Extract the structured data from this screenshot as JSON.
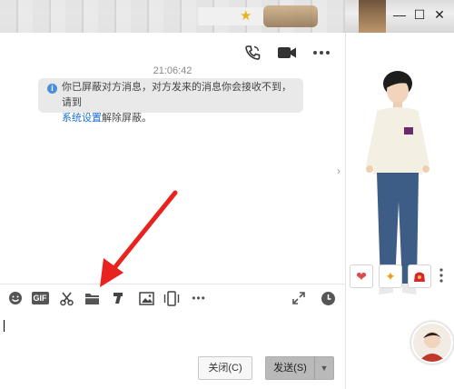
{
  "window": {
    "minimize_glyph": "—",
    "maximize_glyph": "☐",
    "close_glyph": "✕"
  },
  "header": {
    "icons": [
      "phone-icon",
      "video-call-icon",
      "more-icon"
    ]
  },
  "chat": {
    "timestamp": "21:06:42",
    "notice_text": "你已屏蔽对方消息，对方发来的消息你会接收不到，请到",
    "notice_link": "系统设置",
    "notice_tail": "解除屏蔽。"
  },
  "toolbar": {
    "gif_label": "GIF",
    "more_glyph": "•••",
    "tools": [
      "emoji-icon",
      "gif-icon",
      "scissors-icon",
      "folder-icon",
      "music-icon",
      "image-icon",
      "shake-icon",
      "more-icon",
      "expand-icon",
      "history-clock-icon"
    ]
  },
  "footer": {
    "close_label": "关闭(C)",
    "send_label": "发送(S)",
    "send_dropdown": "▼"
  },
  "side": {
    "collapse_glyph": "›",
    "tools": [
      "heart-hand-icon",
      "magic-wand-icon",
      "red-packet-icon",
      "more-vertical-icon"
    ]
  },
  "colors": {
    "accent": "#1b6fd1",
    "arrow": "#e8231f",
    "info": "#4a8fdc"
  }
}
